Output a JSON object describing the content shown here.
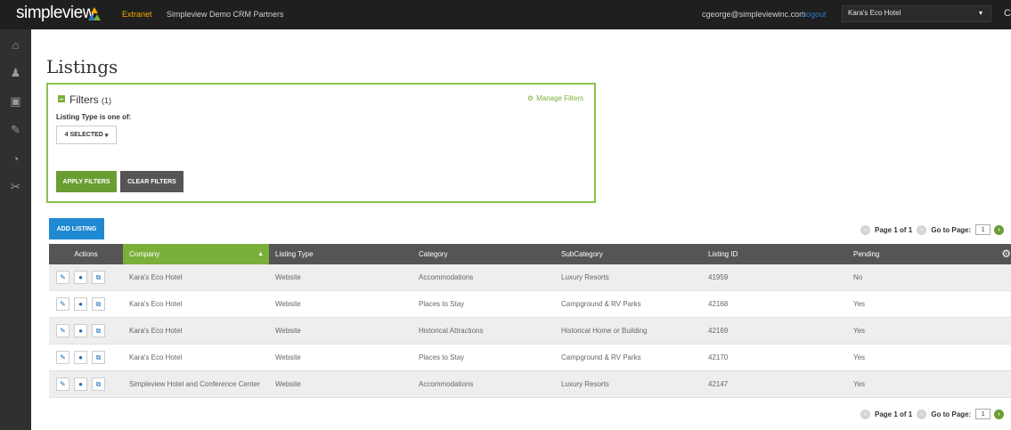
{
  "topbar": {
    "logo": "simpleview",
    "nav": {
      "extranet": "Extranet",
      "partners": "Simpleview Demo CRM Partners"
    },
    "user_email": "cgeorge@simpleviewinc.com",
    "logout": "Logout",
    "hotel_selected": "Kara's Eco Hotel",
    "hotel_caret": "▾",
    "edge_glyph": "C"
  },
  "rail": {
    "icons": [
      "home-icon",
      "user-icon",
      "chart-icon",
      "megaphone-icon",
      "pie-chart-icon",
      "wrench-icon"
    ],
    "glyphs": [
      "⌂",
      "♟",
      "▣",
      "✎",
      "◔",
      "✂"
    ]
  },
  "page": {
    "title": "Listings"
  },
  "filters": {
    "header": "Filters",
    "count": "(1)",
    "manage": "Manage Filters",
    "condition_label": "Listing Type is one of:",
    "selected_label": "4 SELECTED",
    "apply_label": "APPLY FILTERS",
    "clear_label": "CLEAR FILTERS"
  },
  "add_listing_label": "ADD LISTING",
  "pager": {
    "page_text": "Page 1 of 1",
    "goto_text": "Go to Page:",
    "page_value": "1"
  },
  "table": {
    "columns": [
      "Actions",
      "Company",
      "Listing Type",
      "Category",
      "SubCategory",
      "Listing ID",
      "Pending"
    ],
    "rows": [
      [
        "Kara's Eco Hotel",
        "Website",
        "Accommodations",
        "Luxury Resorts",
        "41959",
        "No"
      ],
      [
        "Kara's Eco Hotel",
        "Website",
        "Places to Stay",
        "Campground & RV Parks",
        "42168",
        "Yes"
      ],
      [
        "Kara's Eco Hotel",
        "Website",
        "Historical Attractions",
        "Historical Home or Building",
        "42169",
        "Yes"
      ],
      [
        "Kara's Eco Hotel",
        "Website",
        "Places to Stay",
        "Campground & RV Parks",
        "42170",
        "Yes"
      ],
      [
        "Simpleview Hotel and Conference Center",
        "Website",
        "Accommodations",
        "Luxury Resorts",
        "42147",
        "Yes"
      ]
    ]
  },
  "colors": {
    "accent_green": "#7ab03a",
    "accent_blue": "#1f8ad1",
    "header_gray": "#555555",
    "topbar": "#1f1f1f"
  }
}
